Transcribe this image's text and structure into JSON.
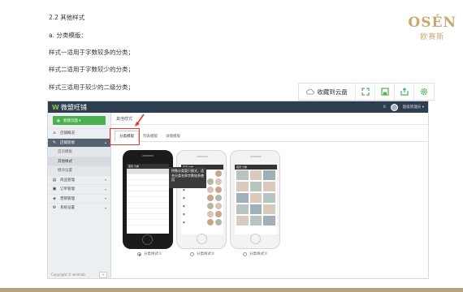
{
  "document": {
    "section_heading": "2.2 其他样式",
    "subheading": "a. 分类模版：",
    "style_lines": [
      "样式一适用于字数较多的分类；",
      "样式二适用于字数较少的分类；",
      "样式三适用于较少的二级分类；"
    ]
  },
  "logo": {
    "brand": "OSÉN",
    "brand_cn": "欧赛斯"
  },
  "toolbar": {
    "save_label": "收藏到云盘"
  },
  "app": {
    "logo_text": "微盟旺铺",
    "top_right_badge": "0",
    "user_label": "超级管理员 ▾",
    "new_button_label": "新建页面 ▾",
    "nav": [
      {
        "icon": "⌂",
        "label": "店铺概况",
        "caret": ""
      },
      {
        "icon": "✎",
        "label": "店铺装修",
        "caret": "▴"
      },
      {
        "icon": "▤",
        "label": "商品管理",
        "caret": "▾"
      },
      {
        "icon": "▣",
        "label": "订单管理",
        "caret": "▾"
      },
      {
        "icon": "◈",
        "label": "营销管理",
        "caret": "▾"
      },
      {
        "icon": "⚙",
        "label": "系统设置",
        "caret": "▾"
      }
    ],
    "sub_nav": [
      "首页模板",
      "其他样式",
      "模块设置"
    ],
    "copyright": "Copyright © weimob",
    "collapse": "«",
    "breadcrumb": "其他样式",
    "tabs": [
      "分类模版",
      "列表模版",
      "详情模版"
    ],
    "tooltip": "特殊分类暂只限式，适合分类名称字数较多使用",
    "phone_title": "首页 分类",
    "radios": [
      "分类样式①",
      "分类样式②",
      "分类样式③"
    ]
  }
}
